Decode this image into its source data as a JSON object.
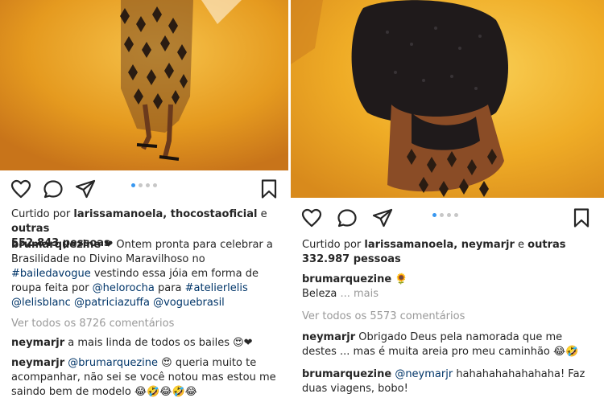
{
  "left_post": {
    "liked_prefix": "Curtido por ",
    "liked_users": "larissamanoela, thocostaoficial",
    "liked_and": " e ",
    "liked_others": "outras",
    "likes_count": "552.843 pessoas",
    "caption": {
      "username": "brumarquezine",
      "heart": "❤",
      "text_1": " Ontem pronta para celebrar a Brasilidade no Divino Maravilhoso no ",
      "hashtag_1": "#bailedavogue",
      "text_2": " vestindo essa jóia em forma de roupa feita por ",
      "mention_1": "@helorocha",
      "text_3": " para ",
      "hashtag_2": "#atelierlelis",
      "text_4": " ",
      "mention_2": "@lelisblanc",
      "text_5": " ",
      "mention_3": "@patriciazuffa",
      "text_6": " ",
      "mention_4": "@voguebrasil"
    },
    "view_comments": "Ver todos os 8726 comentários",
    "comments": [
      {
        "username": "neymarjr",
        "text": " a mais linda de todos os bailes ",
        "emoji": "😍❤"
      },
      {
        "username": "neymarjr",
        "mention": " @brumarquezine ",
        "emoji_a": "😍",
        "text": " queria muito te acompanhar, não sei se você notou mas estou me saindo bem de modelo ",
        "emoji": "😂🤣😂🤣😂"
      }
    ],
    "carousel": {
      "count": 4,
      "active": 0
    }
  },
  "right_post": {
    "liked_prefix": "Curtido por ",
    "liked_users": "larissamanoela, neymarjr",
    "liked_and": " e ",
    "liked_others": "outras",
    "likes_count": "332.987 pessoas",
    "caption": {
      "username": "brumarquezine",
      "emoji": "🌻",
      "text": "Beleza",
      "more": " ... mais"
    },
    "view_comments": "Ver todos os 5573 comentários",
    "comments": [
      {
        "username": "neymarjr",
        "text": " Obrigado Deus pela namorada que me destes ... mas é muita areia pro meu caminhão ",
        "emoji": "😂🤣"
      },
      {
        "username": "brumarquezine",
        "mention": " @neymarjr",
        "text": " hahahahahahahaha! Faz duas viagens, bobo!"
      }
    ],
    "carousel": {
      "count": 4,
      "active": 0
    }
  },
  "colors": {
    "link": "#003569",
    "muted": "#999999",
    "text": "#262626",
    "dot_active": "#3897f0",
    "dot_inactive": "#c7c7c7",
    "photo_orange": "#e7a025"
  },
  "icons": [
    "heart-icon",
    "comment-icon",
    "share-icon",
    "bookmark-icon"
  ]
}
